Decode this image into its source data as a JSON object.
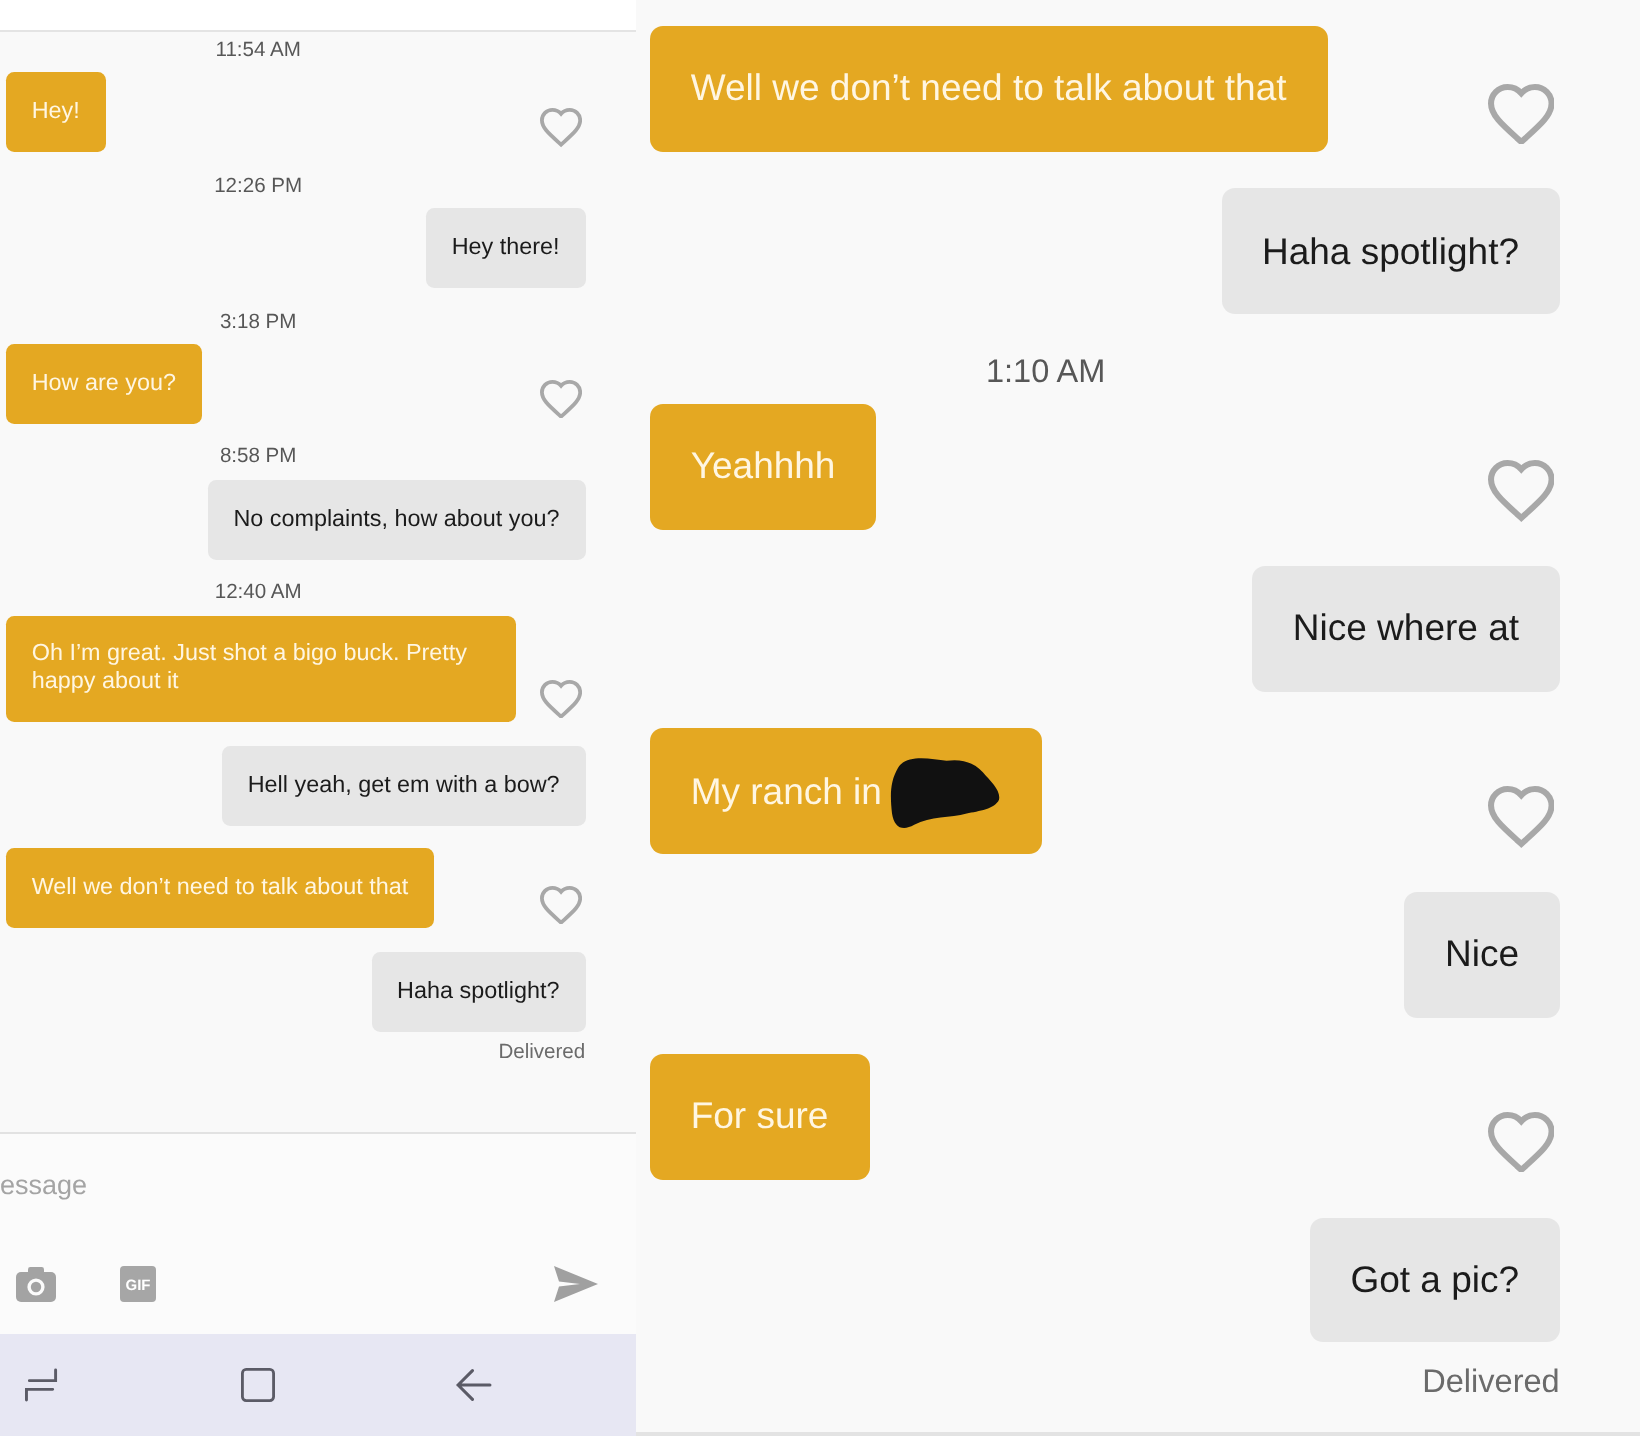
{
  "left_panel": {
    "messages": [
      {
        "kind": "timestamp",
        "text": "11:54 AM"
      },
      {
        "kind": "received",
        "text": "Hey!",
        "liked": false,
        "redacted": false
      },
      {
        "kind": "timestamp",
        "text": "12:26 PM"
      },
      {
        "kind": "sent",
        "text": "Hey there!",
        "redacted": false
      },
      {
        "kind": "timestamp",
        "text": "3:18 PM"
      },
      {
        "kind": "received",
        "text": "How are you?",
        "liked": false,
        "redacted": false
      },
      {
        "kind": "timestamp",
        "text": "8:58 PM"
      },
      {
        "kind": "sent",
        "text": "No complaints, how about you?",
        "redacted": false
      },
      {
        "kind": "timestamp",
        "text": "12:40 AM"
      },
      {
        "kind": "received",
        "text": "Oh I’m great. Just shot a bigo buck. Pretty happy about it",
        "liked": false,
        "redacted": false
      },
      {
        "kind": "sent",
        "text": "Hell yeah, get em with a bow?",
        "redacted": false
      },
      {
        "kind": "received",
        "text": "Well we don’t need to talk about that",
        "liked": false,
        "redacted": false
      },
      {
        "kind": "sent",
        "text": "Haha spotlight?",
        "redacted": false
      }
    ],
    "status": "Delivered",
    "composer": {
      "placeholder": "essage",
      "attachments": [
        {
          "kind": "camera"
        },
        {
          "kind": "gif",
          "label": "GIF"
        }
      ]
    },
    "nav_bar": {
      "buttons": [
        {
          "kind": "recents"
        },
        {
          "kind": "home"
        },
        {
          "kind": "back"
        }
      ]
    }
  },
  "right_panel": {
    "messages": [
      {
        "kind": "received",
        "text": "Well we don’t need to talk about that",
        "liked": false,
        "redacted": false
      },
      {
        "kind": "sent",
        "text": "Haha spotlight?",
        "redacted": false
      },
      {
        "kind": "timestamp",
        "text": "1:10 AM"
      },
      {
        "kind": "received",
        "text": "Yeahhhh",
        "liked": false,
        "redacted": false
      },
      {
        "kind": "sent",
        "text": "Nice where at",
        "redacted": false
      },
      {
        "kind": "received",
        "text": "My ranch in",
        "liked": false,
        "redacted": true
      },
      {
        "kind": "sent",
        "text": "Nice",
        "redacted": false
      },
      {
        "kind": "received",
        "text": "For sure",
        "liked": false,
        "redacted": false
      },
      {
        "kind": "sent",
        "text": "Got a pic?",
        "redacted": false
      }
    ],
    "status": "Delivered"
  }
}
